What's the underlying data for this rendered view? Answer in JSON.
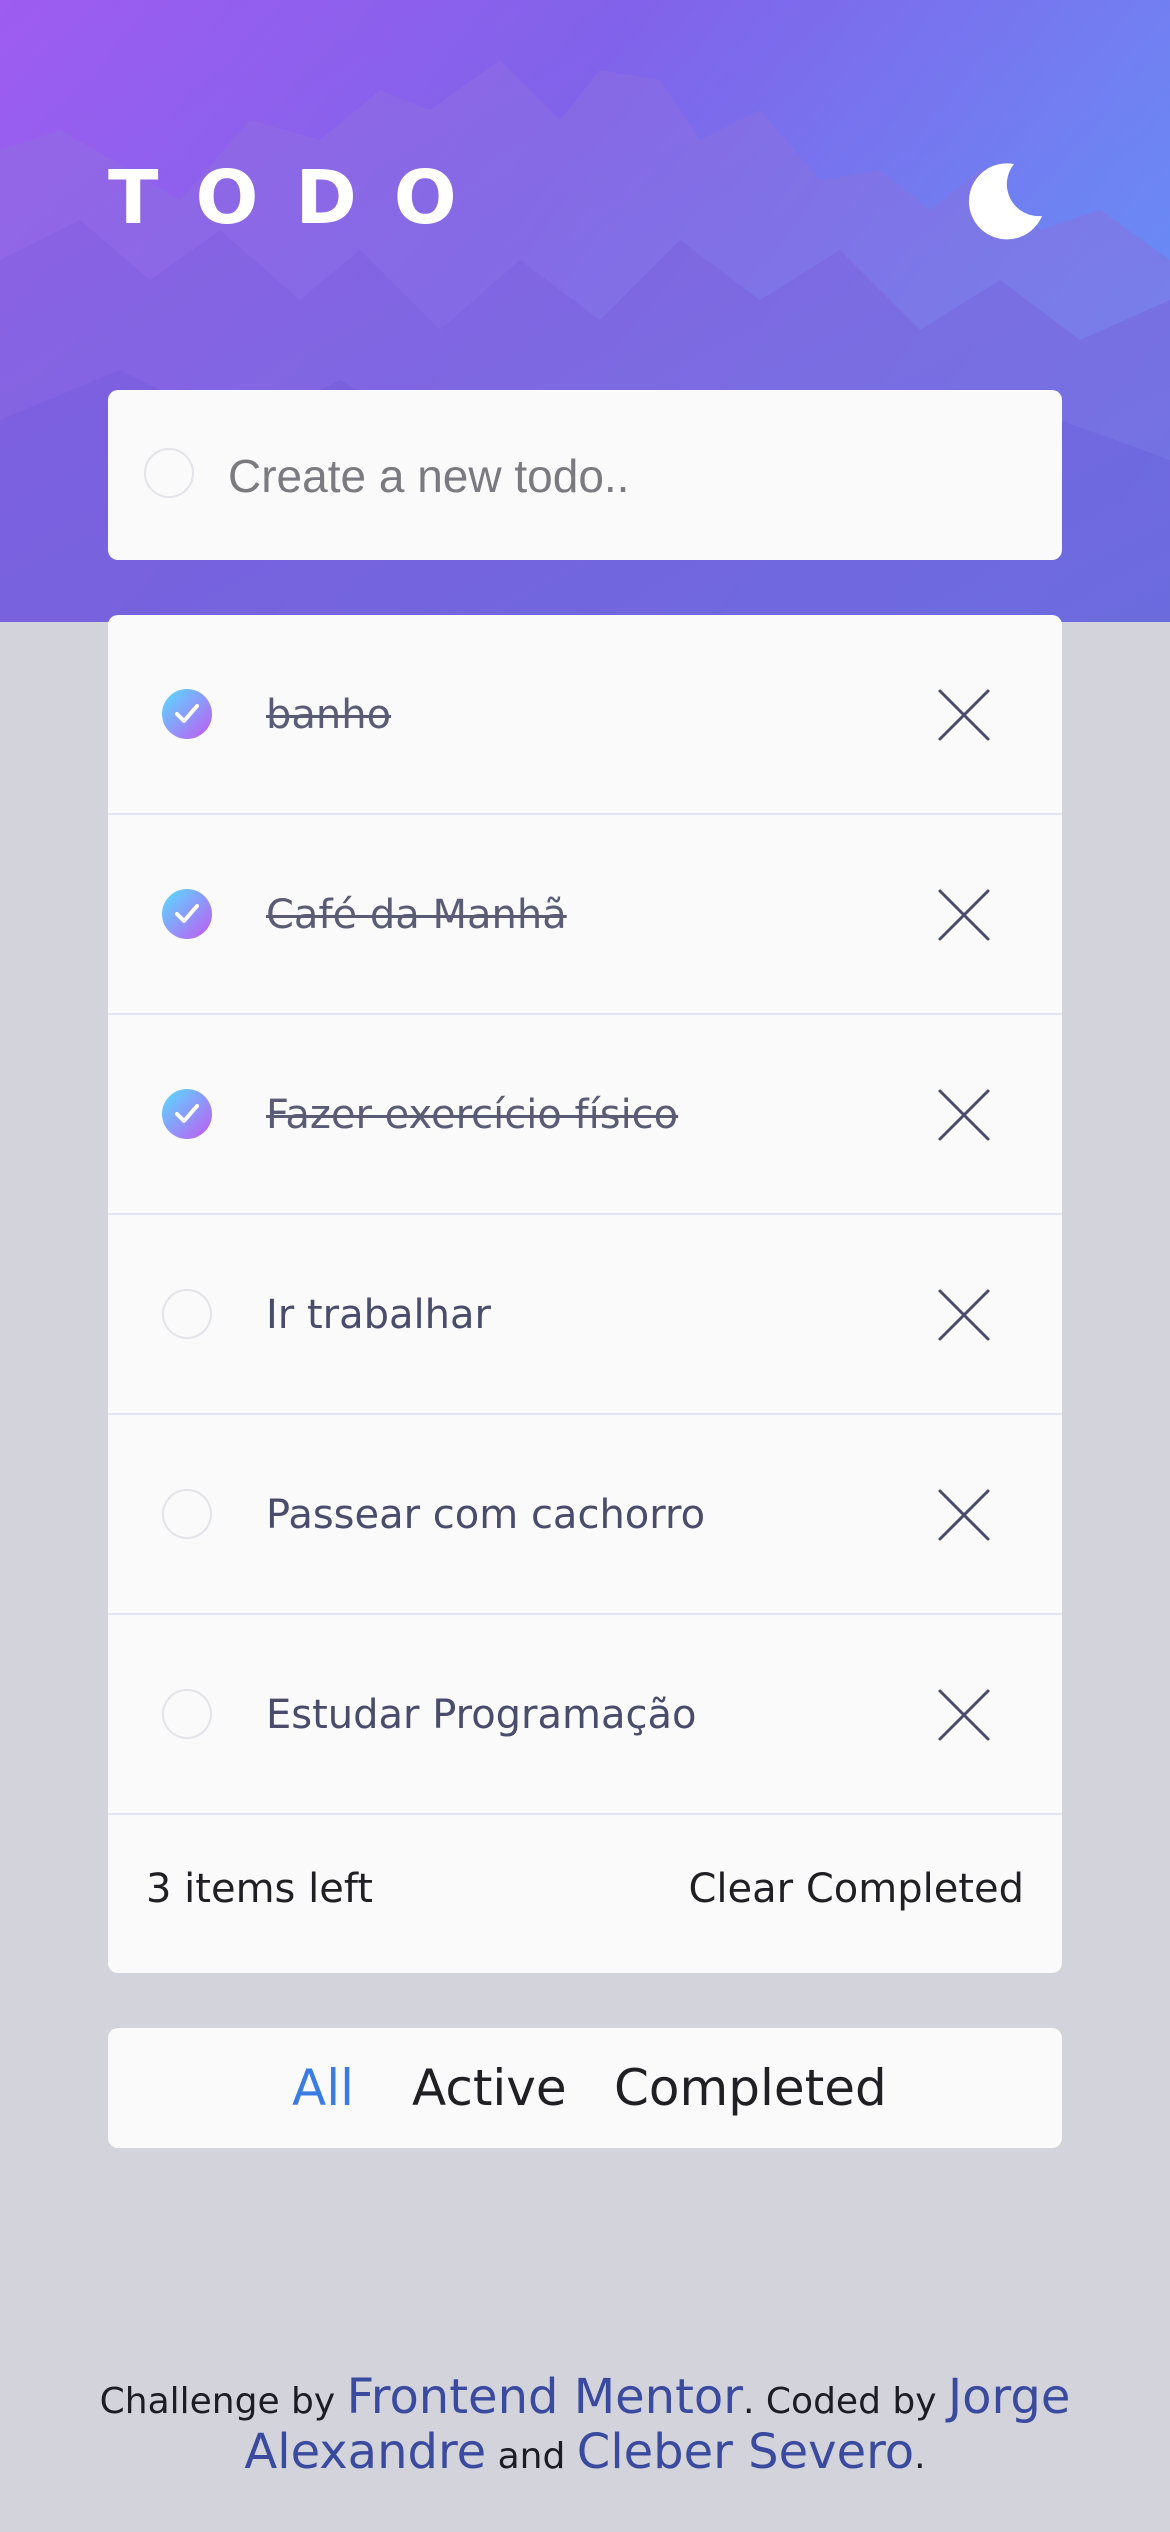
{
  "header": {
    "title": "TODO",
    "theme_toggle_icon": "moon-icon"
  },
  "new_todo": {
    "placeholder": "Create a new todo..",
    "value": ""
  },
  "todos": [
    {
      "text": "banho",
      "completed": true
    },
    {
      "text": "Café da Manhã",
      "completed": true
    },
    {
      "text": "Fazer exercício físico",
      "completed": true
    },
    {
      "text": "Ir trabalhar",
      "completed": false
    },
    {
      "text": "Passear com cachorro",
      "completed": false
    },
    {
      "text": "Estudar Programação",
      "completed": false
    }
  ],
  "list_footer": {
    "items_left": "3 items left",
    "clear_completed": "Clear Completed"
  },
  "filters": {
    "all": "All",
    "active": "Active",
    "completed": "Completed",
    "selected": "All"
  },
  "credit": {
    "prefix": "Challenge by ",
    "frontend_mentor": "Frontend Mentor",
    "coded_by": ". Coded by ",
    "author1": "Jorge Alexandre",
    "and": " and ",
    "author2": "Cleber Severo",
    "suffix": "."
  },
  "colors": {
    "background": "#d3d3dc",
    "card": "#fafafa",
    "accent": "#3a7ce2",
    "gradient_start": "#57ddff",
    "gradient_end": "#c058f3",
    "link": "#3a4a9e"
  }
}
